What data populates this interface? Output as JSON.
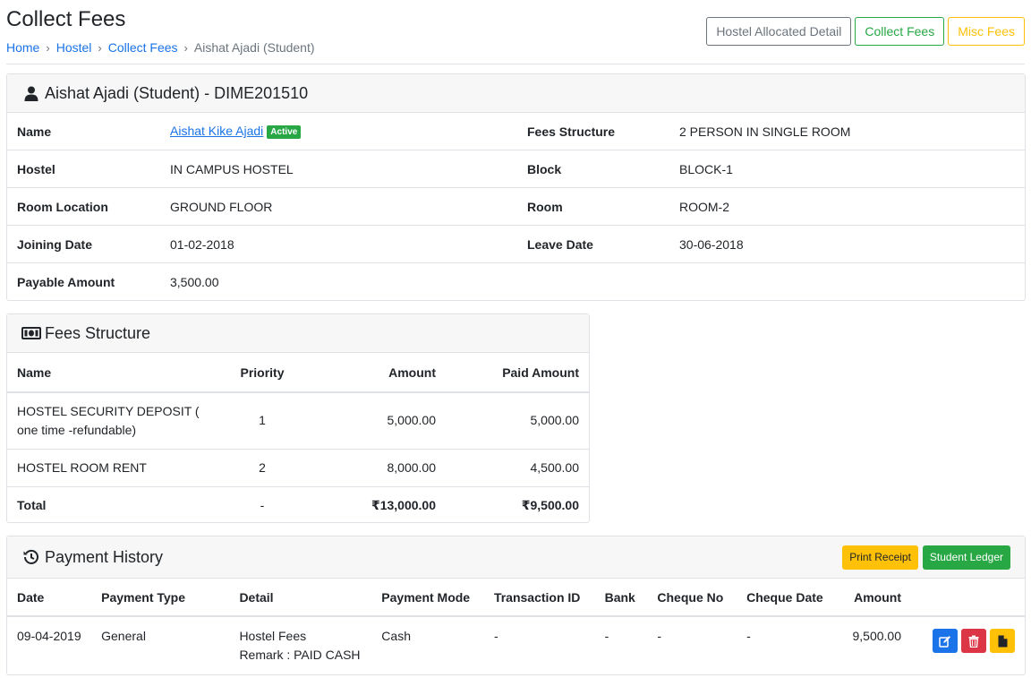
{
  "page": {
    "title": "Collect Fees",
    "breadcrumb": [
      {
        "label": "Home"
      },
      {
        "label": "Hostel"
      },
      {
        "label": "Collect Fees"
      }
    ],
    "breadcrumb_current": "Aishat Ajadi (Student)",
    "buttons": {
      "allocated": "Hostel Allocated Detail",
      "collect": "Collect Fees",
      "misc": "Misc Fees"
    }
  },
  "student": {
    "header": "Aishat Ajadi (Student) - DIME201510",
    "header_icon": "user-icon",
    "labels": {
      "name": "Name",
      "fees_structure": "Fees Structure",
      "hostel": "Hostel",
      "block": "Block",
      "room_location": "Room Location",
      "room": "Room",
      "joining_date": "Joining Date",
      "leave_date": "Leave Date",
      "payable_amount": "Payable Amount"
    },
    "values": {
      "name": "Aishat Kike Ajadi",
      "status": "Active",
      "fees_structure": "2 PERSON IN SINGLE ROOM",
      "hostel": "IN CAMPUS HOSTEL",
      "block": "BLOCK-1",
      "room_location": "GROUND FLOOR",
      "room": "ROOM-2",
      "joining_date": "01-02-2018",
      "leave_date": "30-06-2018",
      "payable_amount": "3,500.00"
    }
  },
  "fees": {
    "header": "Fees Structure",
    "header_icon": "money-icon",
    "columns": [
      "Name",
      "Priority",
      "Amount",
      "Paid Amount"
    ],
    "rows": [
      {
        "name": "HOSTEL SECURITY DEPOSIT ( one time -refundable)",
        "priority": "1",
        "amount": "5,000.00",
        "paid": "5,000.00"
      },
      {
        "name": "HOSTEL ROOM RENT",
        "priority": "2",
        "amount": "8,000.00",
        "paid": "4,500.00"
      }
    ],
    "total": {
      "label": "Total",
      "priority": "-",
      "amount": "₹13,000.00",
      "paid": "₹9,500.00"
    }
  },
  "payments": {
    "header": "Payment History",
    "header_icon": "history-icon",
    "print_receipt": "Print Receipt",
    "student_ledger": "Student Ledger",
    "columns": [
      "Date",
      "Payment Type",
      "Detail",
      "Payment Mode",
      "Transaction ID",
      "Bank",
      "Cheque No",
      "Cheque Date",
      "Amount"
    ],
    "rows": [
      {
        "date": "09-04-2019",
        "type": "General",
        "detail": "Hostel Fees",
        "remark": "Remark : PAID CASH",
        "mode": "Cash",
        "txn": "-",
        "bank": "-",
        "cheque_no": "-",
        "cheque_date": "-",
        "amount": "9,500.00"
      }
    ]
  },
  "colors": {
    "primary": "#1a73e8",
    "success": "#28a745",
    "warning": "#ffc107",
    "danger": "#dc3545",
    "secondary": "#6c757d"
  }
}
